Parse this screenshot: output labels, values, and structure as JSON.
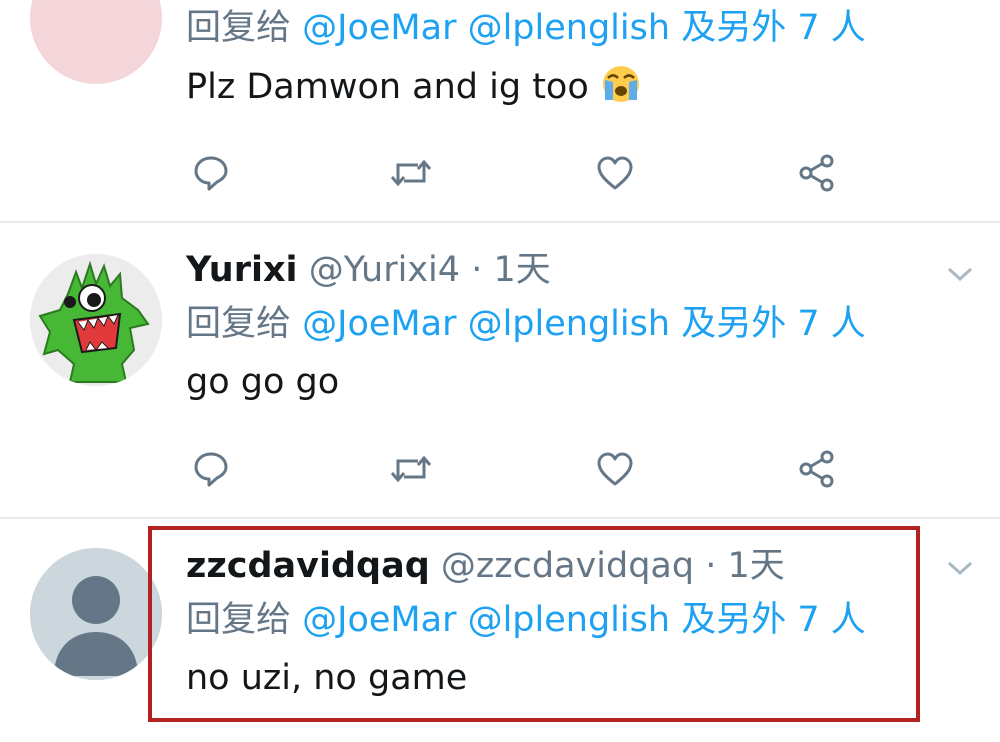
{
  "tweets": [
    {
      "name": "",
      "handle": "",
      "time": "",
      "reply_prefix": "回复给",
      "reply_mentions": "@JoeMar @lplenglish",
      "reply_suffix": "及另外 7 人",
      "text": "Plz Damwon and ig too",
      "emoji": "loudly-crying-face",
      "avatar": "pink-circle"
    },
    {
      "name": "Yurixi",
      "handle": "@Yurixi4",
      "time": "· 1天",
      "reply_prefix": "回复给",
      "reply_mentions": "@JoeMar @lplenglish",
      "reply_suffix": "及另外 7 人",
      "text": "go go go",
      "avatar": "green-monster"
    },
    {
      "name": "zzcdavidqaq",
      "handle": "@zzcdavidqaq",
      "time": "· 1天",
      "reply_prefix": "回复给",
      "reply_mentions": "@JoeMar @lplenglish",
      "reply_suffix": "及另外 7 人",
      "text": "no uzi, no game",
      "avatar": "default-person"
    }
  ],
  "actions": [
    "reply-icon",
    "retweet-icon",
    "like-icon",
    "share-icon"
  ],
  "colors": {
    "accent": "#1da1f2",
    "secondary_text": "#657786",
    "divider": "#e6ecf0",
    "highlight_border": "#b22222"
  }
}
